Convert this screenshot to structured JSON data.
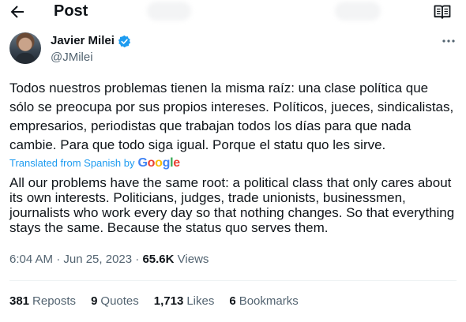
{
  "header": {
    "title": "Post",
    "back_icon": "back-arrow-icon",
    "reader_icon": "reader-mode-icon"
  },
  "author": {
    "name": "Javier Milei",
    "handle": "@JMilei",
    "verified_color": "#1d9bf0"
  },
  "tweet": {
    "text": "Todos nuestros problemas tienen la misma raíz: una clase política que sólo se preocupa por sus propios intereses. Políticos, jueces, sindicalistas, empresarios, periodistas que trabajan todos los días para que nada cambie. Para que todo siga igual. Porque el statu quo les sirve.",
    "translated_label": "Translated from Spanish by",
    "translation_provider": "Google",
    "translation": "All our problems have the same root: a political class that only cares about its own interests. Politicians, judges, trade unionists, businessmen, journalists who work every day so that nothing changes. So that everything stays the same. Because the status quo serves them.",
    "time": "6:04 AM · Jun 25, 2023 ·",
    "views_count": "65.6K",
    "views_label": "Views"
  },
  "stats": {
    "reposts_count": "381",
    "reposts_label": "Reposts",
    "quotes_count": "9",
    "quotes_label": "Quotes",
    "likes_count": "1,713",
    "likes_label": "Likes",
    "bookmarks_count": "6",
    "bookmarks_label": "Bookmarks"
  },
  "colors": {
    "link": "#1d9bf0",
    "secondary_text": "#536471",
    "primary_text": "#0f1419"
  }
}
